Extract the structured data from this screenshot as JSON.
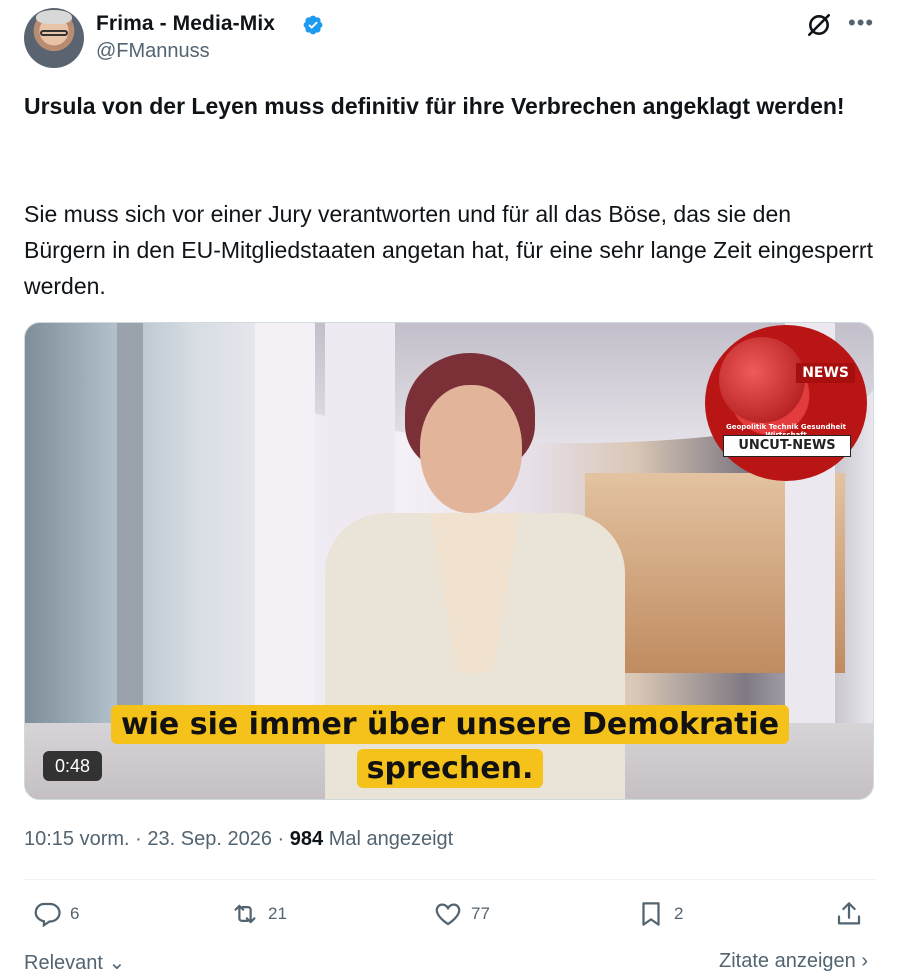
{
  "author": {
    "display_name": "Frima - Media-Mix",
    "handle": "@FMannuss",
    "verified": true,
    "verified_color": "#1d9bf0"
  },
  "header_icons": [
    "grok-icon",
    "more-icon"
  ],
  "tweet": {
    "title": "Ursula von der Leyen muss definitiv für ihre Verbrechen angeklagt werden!",
    "body": "Sie muss sich vor einer Jury verantworten und für all das Böse, das sie den Bürgern in den EU-Mitgliedstaaten angetan hat, für eine sehr lange Zeit eingesperrt werden."
  },
  "video": {
    "caption_line1": "wie sie immer über unsere Demokratie",
    "caption_line2": "sprechen.",
    "duration": "0:48",
    "logo_tag": "NEWS",
    "logo_subtitle": "Geopolitik Technik Gesundheit Wirtschaft",
    "logo_name": "UNCUT-NEWS",
    "caption_color": "#f5c21b"
  },
  "meta": {
    "time": "10:15 vorm.",
    "separator": "·",
    "date": "23. Sep. 2026",
    "views_count": "984",
    "views_label": "Mal angezeigt"
  },
  "actions": {
    "replies": "6",
    "reposts": "21",
    "likes": "77",
    "bookmarks": "2"
  },
  "footer": {
    "sort_label": "Relevant",
    "quotes_label": "Zitate anzeigen"
  }
}
